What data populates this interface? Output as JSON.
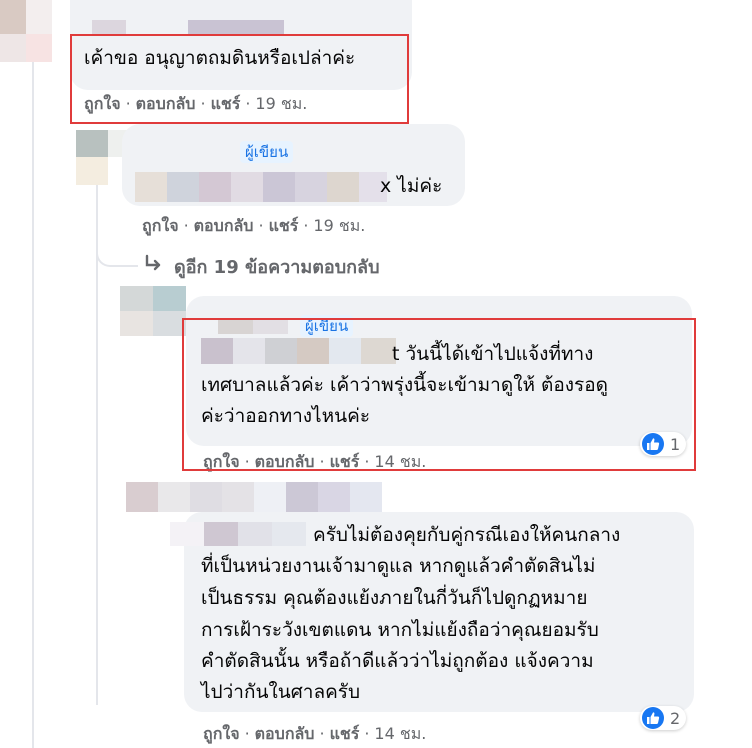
{
  "comments": [
    {
      "text": "เค้าขอ อนุญาตถมดินหรือเปล่าค่ะ",
      "actions": {
        "like": "ถูกใจ",
        "reply": "ตอบกลับ",
        "share": "แชร์",
        "time": "19 ชม."
      }
    },
    {
      "badge": "ผู้เขียน",
      "text_suffix": "x ไม่ค่ะ",
      "actions": {
        "like": "ถูกใจ",
        "reply": "ตอบกลับ",
        "share": "แชร์",
        "time": "19 ชม."
      }
    },
    {
      "more_replies": "ดูอีก 19 ข้อความตอบกลับ"
    },
    {
      "badge": "ผู้เขียน",
      "line1_suffix": "t วันนี้ได้เข้าไปแจ้งที่ทาง",
      "line2": "เทศบาลแล้วค่ะ เค้าว่าพรุ่งนี้จะเข้ามาดูให้ ต้องรอดู",
      "line3": "ค่ะว่าออกทางไหนค่ะ",
      "reaction_count": "1",
      "actions": {
        "like": "ถูกใจ",
        "reply": "ตอบกลับ",
        "share": "แชร์",
        "time": "14 ชม."
      }
    },
    {
      "line1_suffix": "ครับไม่ต้องคุยกับคู่กรณีเองให้คนกลาง",
      "line2": "ที่เป็นหน่วยงานเจ้ามาดูแล หากดูแล้วคำตัดสินไม่",
      "line3": "เป็นธรรม คุณต้องแย้งภายในกี่วันก็ไปดูกฏหมาย",
      "line4": "การเฝ้าระวังเขตแดน หากไม่แย้งถือว่าคุณยอมรับ",
      "line5": "คำตัดสินนั้น หรือถ้าดีแล้วว่าไม่ถูกต้อง แจ้งความ",
      "line6": "ไปว่ากันในศาลครับ",
      "reaction_count": "2",
      "actions": {
        "like": "ถูกใจ",
        "reply": "ตอบกลับ",
        "share": "แชร์",
        "time": "14 ชม."
      }
    }
  ],
  "colors": {
    "highlight": "#e03b3b",
    "badge": "#1b74e4",
    "like": "#1877f2",
    "bubble": "#f0f2f5"
  },
  "icons": {
    "like": "thumbs-up-icon",
    "reply_arrow": "reply-arrow-icon"
  }
}
